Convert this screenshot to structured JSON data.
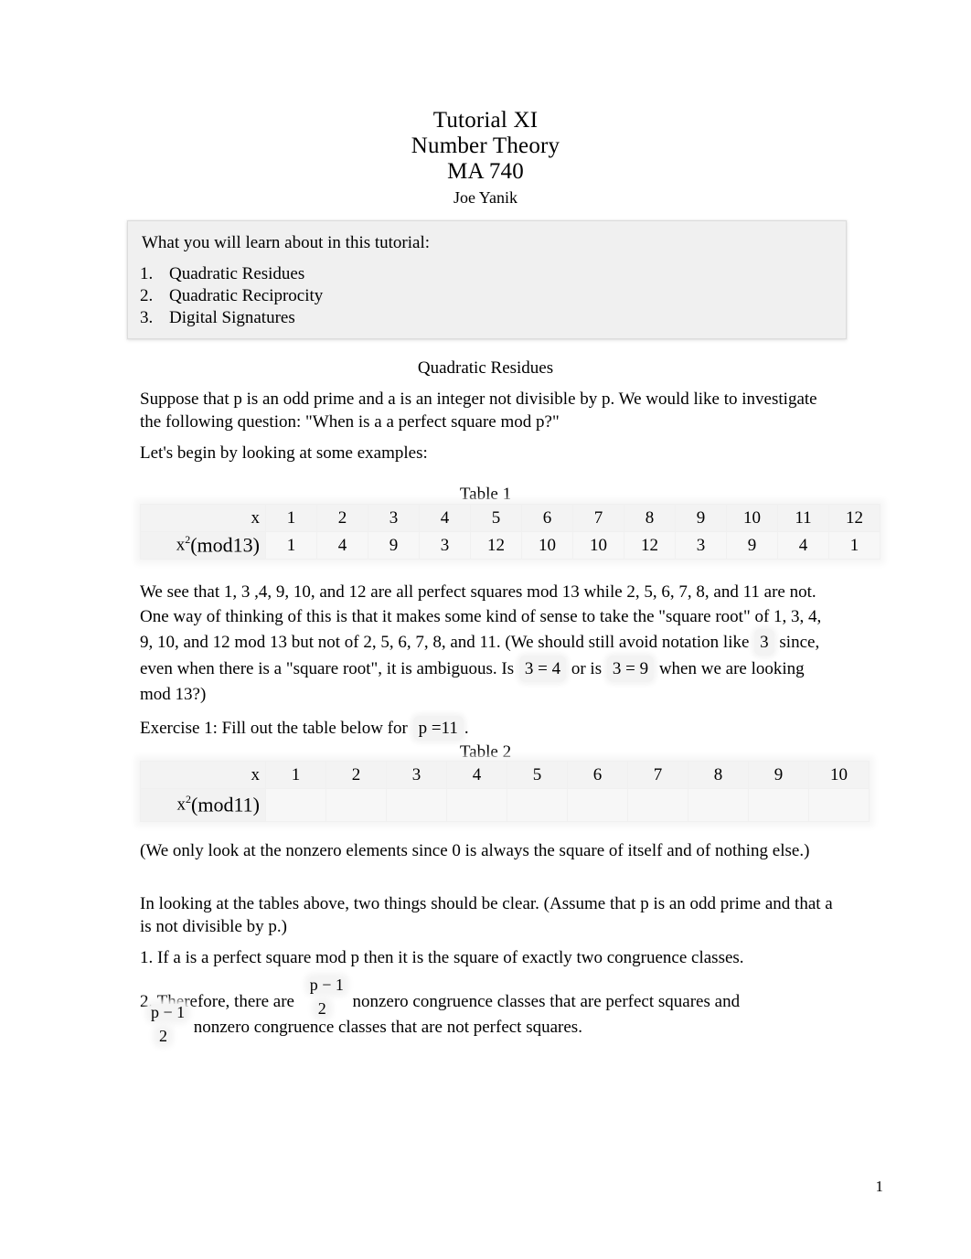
{
  "document": {
    "title_lines": [
      "Tutorial XI",
      "Number Theory",
      "MA 740"
    ],
    "author": "Joe Yanik",
    "page_number": "1"
  },
  "intro_box": {
    "heading": "What you will learn about in this tutorial:",
    "items": [
      {
        "number": "1.",
        "label": "Quadratic Residues"
      },
      {
        "number": "2.",
        "label": "Quadratic Reciprocity"
      },
      {
        "number": "3.",
        "label": "Digital Signatures"
      }
    ]
  },
  "section": {
    "heading": "Quadratic Residues"
  },
  "paragraphs": {
    "suppose": "Suppose that p is an odd prime and a is an integer not divisible by p. We would like to investigate the following question: \"When is a a perfect square mod p?\"",
    "lets_begin": "Let's begin by looking at some examples:",
    "we_see_part1": "We see that 1, 3 ,4, 9, 10, and 12 are all perfect squares mod 13 while 2, 5, 6, 7, 8, and 11 are not. One way of thinking of this is that it makes some kind of sense to take the \"square root\" of 1, 3, 4, 9, 10, and 12 mod 13 but not of  2, 5, 6, 7, 8, and 11. (We should still avoid notation like",
    "we_see_eq1": "3",
    "we_see_part2": "since, even when there is a \"square root\", it is ambiguous. Is",
    "we_see_eq2": "3 = 4",
    "we_see_part3": "or is",
    "we_see_eq3": "3 = 9",
    "we_see_part4": "when we are looking mod 13?)",
    "exercise_label": "Exercise 1:  Fill out the table below for",
    "exercise_eq": "p =11",
    "exercise_end": ".",
    "only_nonzero": "(We only look at the nonzero elements since 0 is always the square of itself and of nothing else.)",
    "in_looking": "In looking at the tables above, two things should be clear. (Assume that p is an odd prime and that a is not divisible by p.)",
    "fact1": "1. If a is a perfect square mod p then it is the square of exactly two congruence classes.",
    "fact2_pre": "2. Therefore, there are",
    "fact2_frac": {
      "numerator": "p − 1",
      "denominator": "2"
    },
    "fact2_mid": "nonzero congruence classes that are perfect squares and",
    "fact2_frac2": {
      "numerator": "p − 1",
      "denominator": "2"
    },
    "fact2_end": "nonzero congruence classes that are not perfect squares."
  },
  "table1": {
    "caption": "Table 1",
    "row_label_x": "x",
    "row_label_sq_base": "x",
    "row_label_sq_exp": "2",
    "row_label_sq_mod": "(mod13)",
    "x_values": [
      "1",
      "2",
      "3",
      "4",
      "5",
      "6",
      "7",
      "8",
      "9",
      "10",
      "11",
      "12"
    ],
    "sq_values": [
      "1",
      "4",
      "9",
      "3",
      "12",
      "10",
      "10",
      "12",
      "3",
      "9",
      "4",
      "1"
    ]
  },
  "table2": {
    "caption": "Table 2",
    "row_label_x": "x",
    "row_label_sq_base": "x",
    "row_label_sq_exp": "2",
    "row_label_sq_mod": "(mod11)",
    "x_values": [
      "1",
      "2",
      "3",
      "4",
      "5",
      "6",
      "7",
      "8",
      "9",
      "10"
    ],
    "sq_values": [
      "",
      "",
      "",
      "",
      "",
      "",
      "",
      "",
      "",
      ""
    ]
  },
  "colors": {
    "page_background": "#ffffff",
    "text": "#000000",
    "callout_background": "#f0f0f0",
    "callout_border": "#dcdcdc",
    "table_background": "#f5f5f5"
  }
}
